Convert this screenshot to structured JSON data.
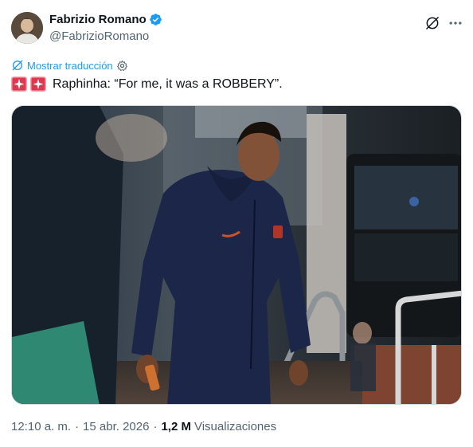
{
  "author": {
    "display_name": "Fabrizio Romano",
    "handle": "@FabrizioRomano",
    "verified": true,
    "avatar_icon": "avatar-photo"
  },
  "actions": {
    "grok_icon": "grok-icon",
    "more_icon": "more-dots-icon"
  },
  "translation": {
    "label": "Mostrar traducción",
    "settings_icon": "gear-icon"
  },
  "tweet": {
    "emoji": [
      "rotating-light-emoji",
      "rotating-light-emoji"
    ],
    "text": "Raphinha: “For me, it was a ROBBERY”."
  },
  "media": {
    "type": "photo",
    "subject": "player-walking-in-tracksuit"
  },
  "meta": {
    "time": "12:10 a. m.",
    "separator": "·",
    "date": "15 abr. 2026",
    "views_count": "1,2 M",
    "views_label": "Visualizaciones"
  },
  "colors": {
    "accent": "#1d9bf0",
    "text": "#0f1419",
    "secondary": "#536471",
    "verified": "#1d9bf0"
  }
}
